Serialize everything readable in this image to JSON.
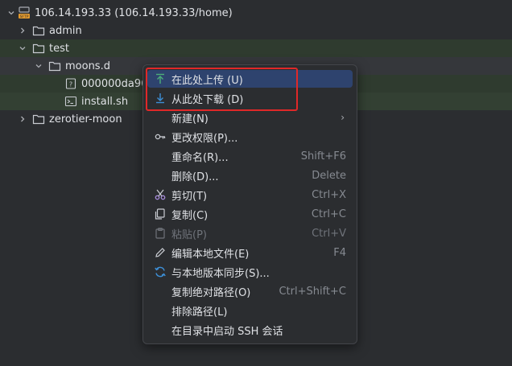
{
  "tree": {
    "root": {
      "label": "106.14.193.33 (106.14.193.33/home)",
      "icon": "sftp-server-icon"
    },
    "items": [
      {
        "label": "admin",
        "icon": "folder-icon",
        "expanded": false
      },
      {
        "label": "test",
        "icon": "folder-icon",
        "expanded": true
      },
      {
        "label": "moons.d",
        "icon": "folder-icon",
        "expanded": true
      },
      {
        "label": "000000da96",
        "icon": "unknown-file-icon"
      },
      {
        "label": "install.sh",
        "icon": "shell-script-icon"
      },
      {
        "label": "zerotier-moon",
        "icon": "folder-icon",
        "expanded": false
      }
    ]
  },
  "menu": {
    "items": [
      {
        "label": "在此处上传 (U)",
        "shortcut": "",
        "icon": "upload-icon"
      },
      {
        "label": "从此处下载 (D)",
        "shortcut": "",
        "icon": "download-icon"
      },
      {
        "label": "新建(N)",
        "shortcut": "",
        "submenu": "›"
      },
      {
        "label": "更改权限(P)...",
        "shortcut": "",
        "icon": "key-icon"
      },
      {
        "label": "重命名(R)...",
        "shortcut": "Shift+F6"
      },
      {
        "label": "删除(D)...",
        "shortcut": "Delete"
      },
      {
        "label": "剪切(T)",
        "shortcut": "Ctrl+X",
        "icon": "scissors-icon"
      },
      {
        "label": "复制(C)",
        "shortcut": "Ctrl+C",
        "icon": "copy-icon"
      },
      {
        "label": "粘贴(P)",
        "shortcut": "Ctrl+V",
        "icon": "paste-icon",
        "disabled": true
      },
      {
        "label": "编辑本地文件(E)",
        "shortcut": "F4",
        "icon": "pencil-icon"
      },
      {
        "label": "与本地版本同步(S)...",
        "shortcut": "",
        "icon": "sync-icon"
      },
      {
        "label": "复制绝对路径(O)",
        "shortcut": "Ctrl+Shift+C"
      },
      {
        "label": "排除路径(L)",
        "shortcut": ""
      },
      {
        "label": "在目录中启动 SSH 会话",
        "shortcut": ""
      }
    ]
  },
  "colors": {
    "background": "#2b2d30",
    "selection": "#2e436e",
    "highlight_green": "#2f3b2f",
    "annotation_red": "#e02828",
    "upload_icon": "#4cae7a",
    "download_icon": "#3d8fd6"
  }
}
